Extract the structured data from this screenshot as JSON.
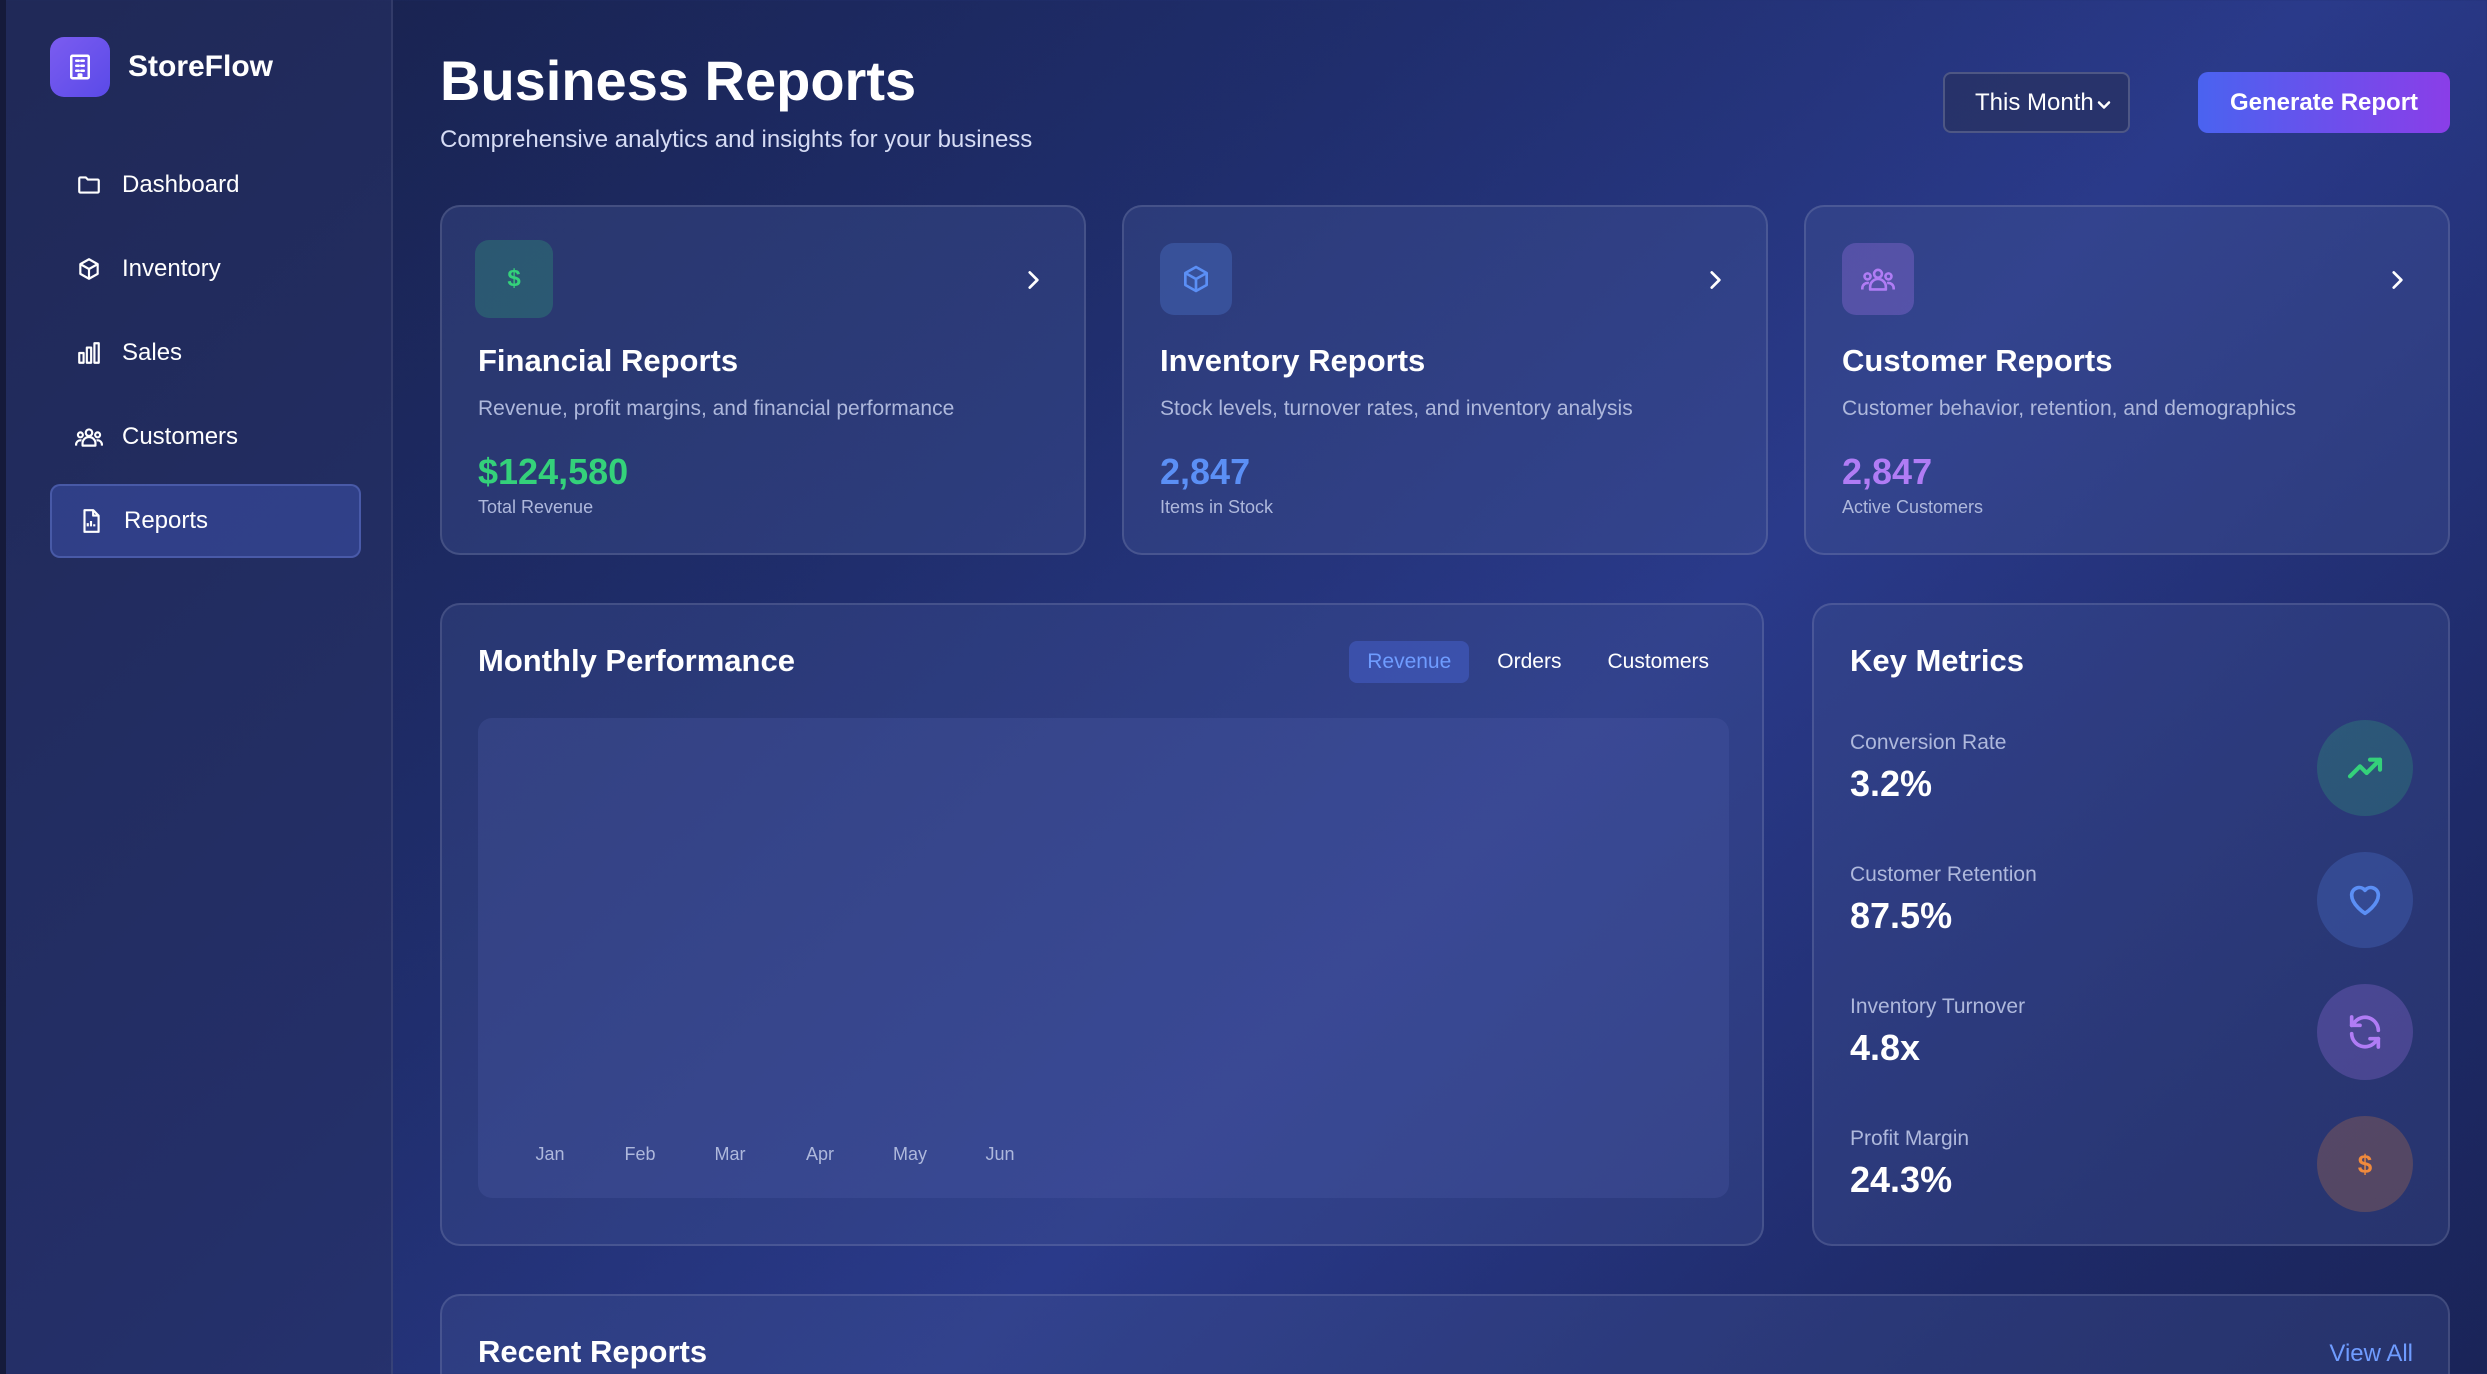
{
  "app": {
    "name": "StoreFlow"
  },
  "sidebar": {
    "items": [
      {
        "label": "Dashboard",
        "icon": "folder-icon"
      },
      {
        "label": "Inventory",
        "icon": "box-icon"
      },
      {
        "label": "Sales",
        "icon": "bar-chart-icon"
      },
      {
        "label": "Customers",
        "icon": "users-icon"
      },
      {
        "label": "Reports",
        "icon": "report-icon",
        "active": true
      }
    ]
  },
  "header": {
    "title": "Business Reports",
    "subtitle": "Comprehensive analytics and insights for your business",
    "period": "This Month",
    "generate_label": "Generate Report"
  },
  "cards": [
    {
      "title": "Financial Reports",
      "description": "Revenue, profit margins, and financial performance",
      "value": "$124,580",
      "caption": "Total Revenue",
      "icon": "dollar-icon",
      "accent": "#34d17a"
    },
    {
      "title": "Inventory Reports",
      "description": "Stock levels, turnover rates, and inventory analysis",
      "value": "2,847",
      "caption": "Items in Stock",
      "icon": "box-icon",
      "accent": "#5b8ff5"
    },
    {
      "title": "Customer Reports",
      "description": "Customer behavior, retention, and demographics",
      "value": "2,847",
      "caption": "Active Customers",
      "icon": "users-icon",
      "accent": "#b07cf5"
    }
  ],
  "performance": {
    "title": "Monthly Performance",
    "tabs": [
      {
        "label": "Revenue",
        "active": true
      },
      {
        "label": "Orders"
      },
      {
        "label": "Customers"
      }
    ]
  },
  "chart_data": {
    "type": "bar",
    "categories": [
      "Jan",
      "Feb",
      "Mar",
      "Apr",
      "May",
      "Jun"
    ],
    "series": []
  },
  "metrics": {
    "title": "Key Metrics",
    "items": [
      {
        "label": "Conversion Rate",
        "value": "3.2%",
        "icon": "trending-up-icon",
        "color": "#34d17a"
      },
      {
        "label": "Customer Retention",
        "value": "87.5%",
        "icon": "heart-icon",
        "color": "#5b8ff5"
      },
      {
        "label": "Inventory Turnover",
        "value": "4.8x",
        "icon": "refresh-icon",
        "color": "#b07cf5"
      },
      {
        "label": "Profit Margin",
        "value": "24.3%",
        "icon": "dollar-icon",
        "color": "#f08a3c"
      }
    ]
  },
  "recent": {
    "title": "Recent Reports",
    "view_all": "View All"
  },
  "colors": {
    "accent_blue": "#4a63f0",
    "accent_purple": "#8a3ee8",
    "link": "#6f9cff"
  }
}
